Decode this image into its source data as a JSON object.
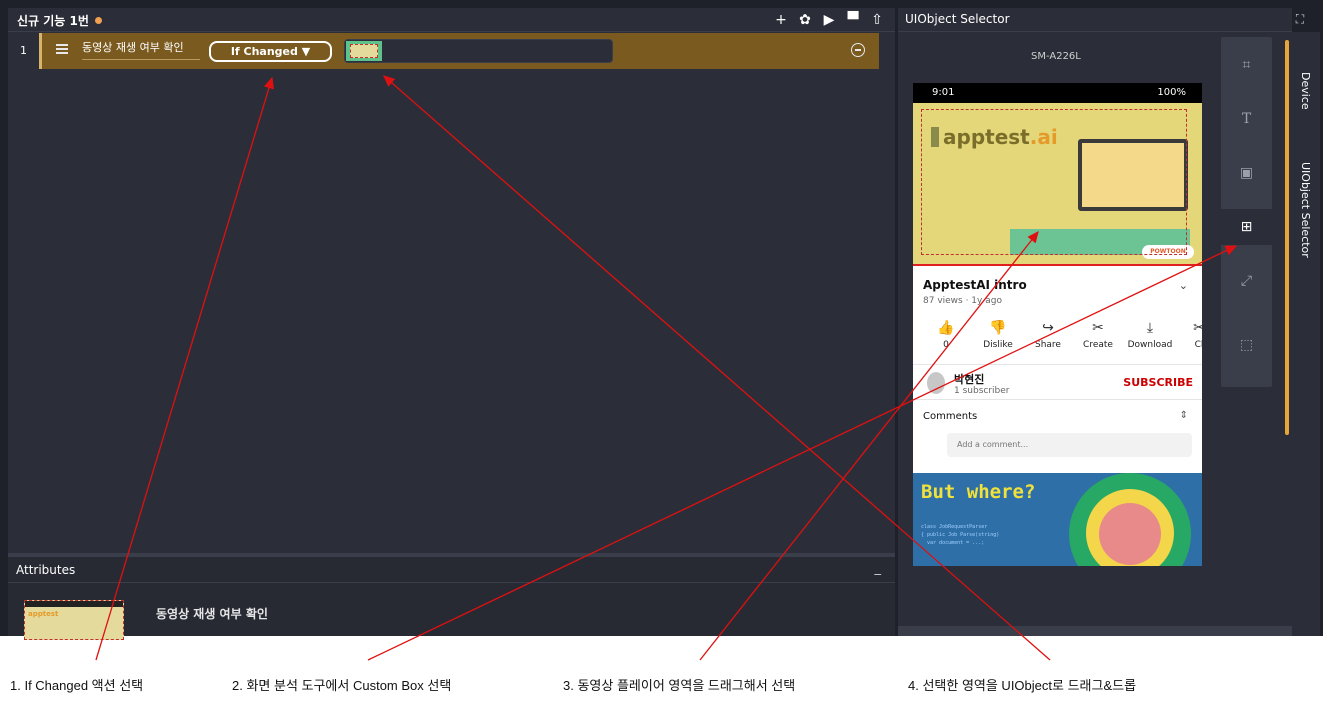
{
  "editor": {
    "title": "신규 기능 1번",
    "toolbar": {
      "add": "+",
      "settings": "✿",
      "run": "▶",
      "save": "▀",
      "export": "⇧"
    },
    "steps": [
      {
        "number": "1",
        "label": "동영상 재생 여부 확인",
        "action": "If Changed ▼"
      }
    ]
  },
  "attributes": {
    "title": "Attributes",
    "minimize": "_",
    "name": "동영상 재생 여부 확인"
  },
  "selector": {
    "title": "UIObject Selector",
    "device": "SM-A226L",
    "tabs": [
      "Device",
      "UIObject Selector"
    ],
    "tools": [
      "object-select-icon",
      "text-select-icon",
      "image-select-icon",
      "custom-box-icon",
      "expand-icon",
      "crop-select-icon"
    ]
  },
  "phone": {
    "status_time": "9:01",
    "status_right": "100%",
    "video_logo_a": "apptest",
    "video_logo_b": ".ai",
    "video_badge": "POWTOON",
    "video_title": "ApptestAI intro",
    "video_meta": "87 views · 1y ago",
    "actions": [
      {
        "icon": "like-icon",
        "glyph": "👍",
        "label": "0"
      },
      {
        "icon": "dislike-icon",
        "glyph": "👎",
        "label": "Dislike"
      },
      {
        "icon": "share-icon",
        "glyph": "↪",
        "label": "Share"
      },
      {
        "icon": "create-icon",
        "glyph": "✂",
        "label": "Create"
      },
      {
        "icon": "download-icon",
        "glyph": "⤓",
        "label": "Download"
      },
      {
        "icon": "clip-icon",
        "glyph": "✂",
        "label": "Cl"
      }
    ],
    "channel_name": "박현진",
    "channel_subs": "1 subscriber",
    "subscribe": "SUBSCRIBE",
    "comments": "Comments",
    "add_comment": "Add a comment...",
    "next_video_title": "But where?"
  },
  "captions": [
    "1. If Changed 액션 선택",
    "2. 화면 분석 도구에서 Custom Box 선택",
    "3. 동영상 플레이어 영역을 드래그해서 선택",
    "4. 선택한 영역을 UIObject로 드래그&드롭"
  ],
  "colors": {
    "app_bg": "#1e2129",
    "panel_bg": "#2b2e38",
    "step_row": "#7a5a1e",
    "accent": "#e8a63a",
    "arrow": "#e01010"
  }
}
